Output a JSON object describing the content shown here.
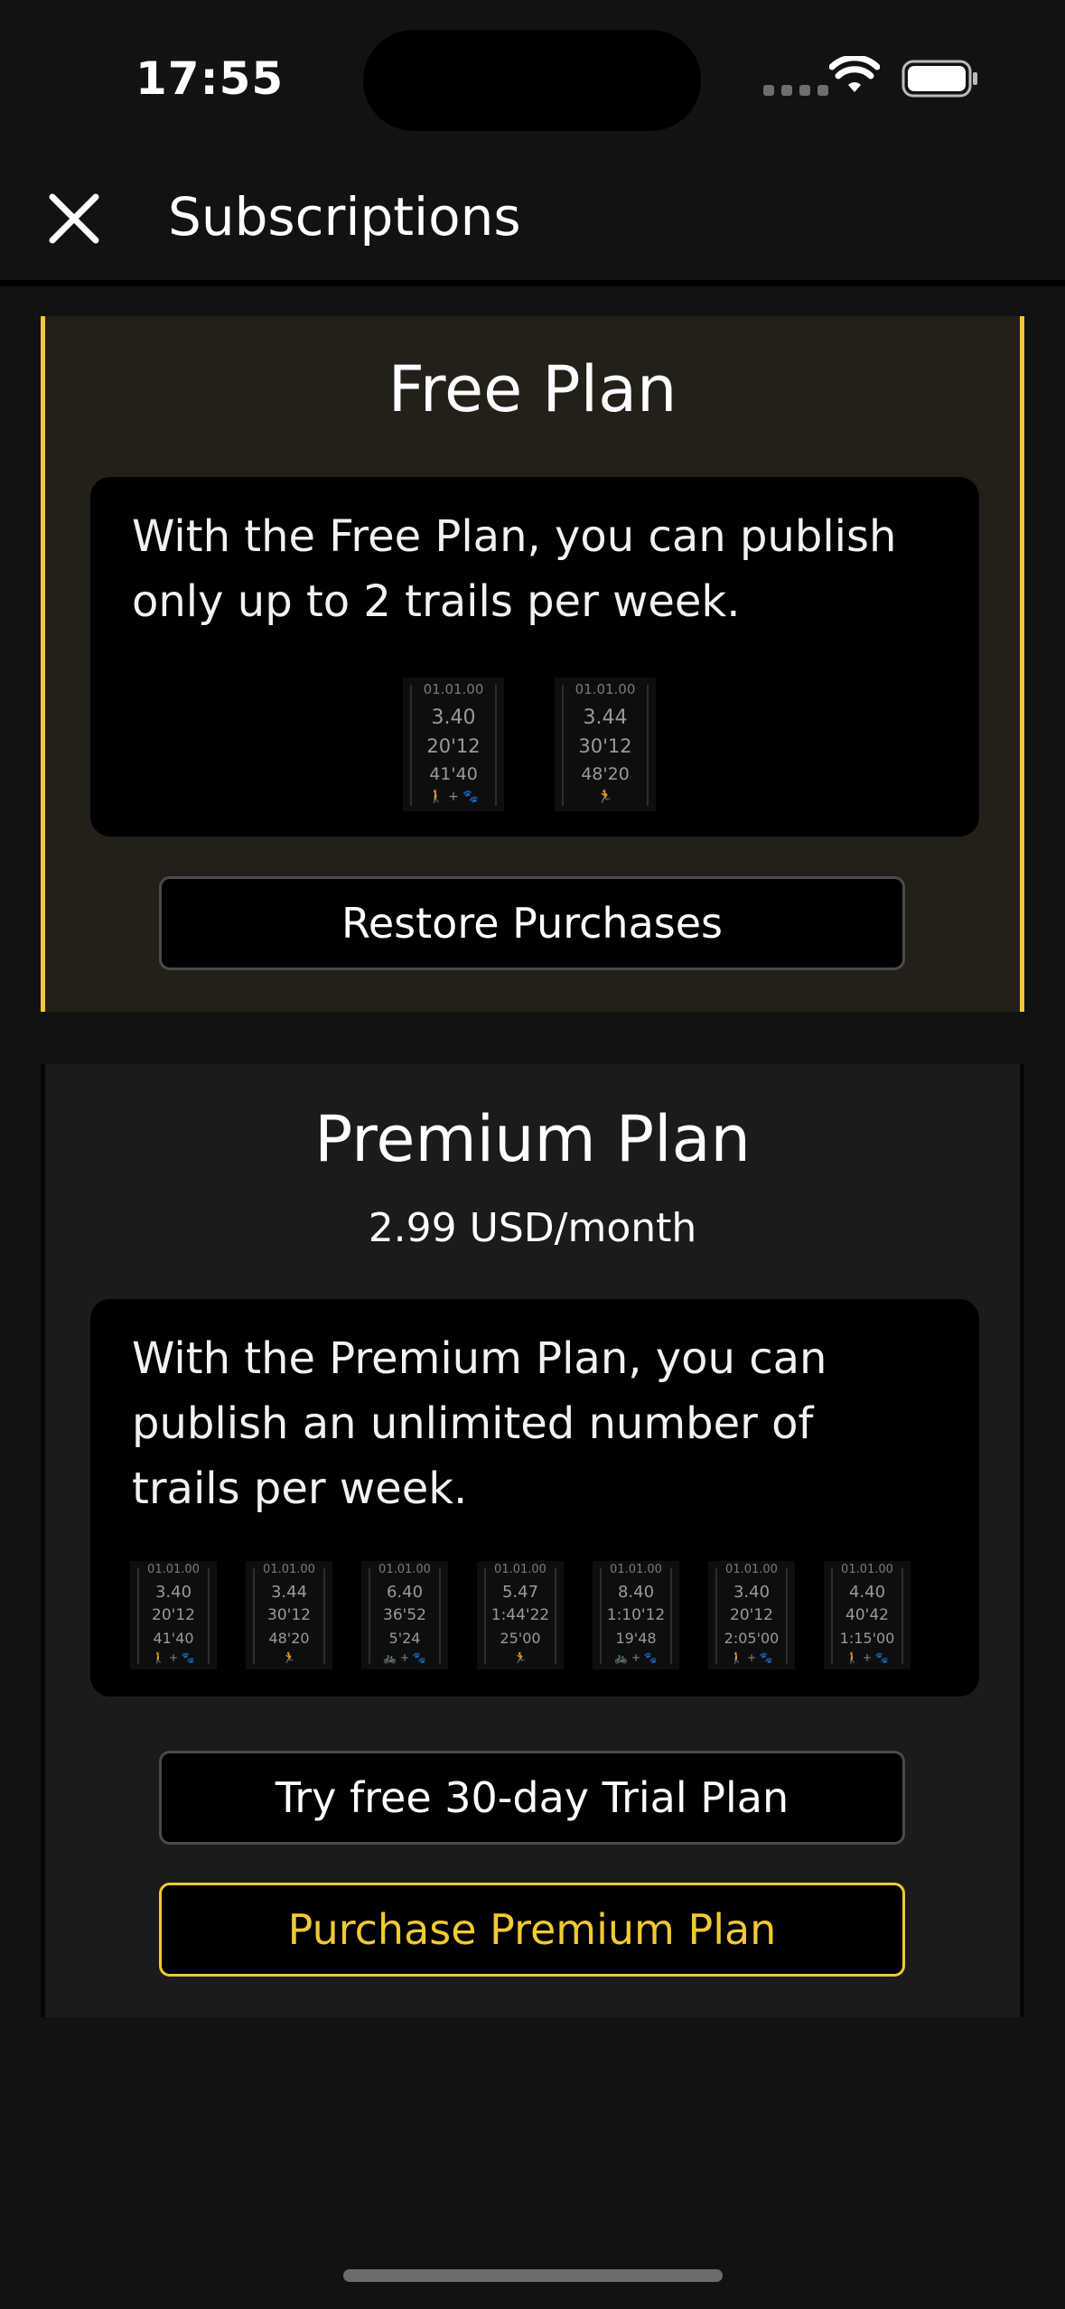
{
  "status_bar": {
    "time": "17:55"
  },
  "nav": {
    "title": "Subscriptions"
  },
  "free_plan": {
    "title": "Free Plan",
    "description": "With the Free Plan, you can publish only up to 2 trails per week.",
    "badges": [
      {
        "date": "01.01.00",
        "distance": "3.40",
        "time": "20'12",
        "pace": "41'40",
        "icons": "🚶 + 🐾"
      },
      {
        "date": "01.01.00",
        "distance": "3.44",
        "time": "30'12",
        "pace": "48'20",
        "icons": "🏃"
      }
    ],
    "restore_label": "Restore Purchases"
  },
  "premium_plan": {
    "title": "Premium Plan",
    "price": "2.99 USD/month",
    "description": "With the Premium Plan, you can publish an unlimited number of trails per week.",
    "badges": [
      {
        "date": "01.01.00",
        "distance": "3.40",
        "time": "20'12",
        "pace": "41'40",
        "icons": "🚶 + 🐾"
      },
      {
        "date": "01.01.00",
        "distance": "3.44",
        "time": "30'12",
        "pace": "48'20",
        "icons": "🏃"
      },
      {
        "date": "01.01.00",
        "distance": "6.40",
        "time": "36'52",
        "pace": "5'24",
        "icons": "🚲 + 🐾"
      },
      {
        "date": "01.01.00",
        "distance": "5.47",
        "time": "1:44'22",
        "pace": "25'00",
        "icons": "🏃"
      },
      {
        "date": "01.01.00",
        "distance": "8.40",
        "time": "1:10'12",
        "pace": "19'48",
        "icons": "🚲 + 🐾"
      },
      {
        "date": "01.01.00",
        "distance": "3.40",
        "time": "20'12",
        "pace": "2:05'00",
        "icons": "🚶 + 🐾"
      },
      {
        "date": "01.01.00",
        "distance": "4.40",
        "time": "40'42",
        "pace": "1:15'00",
        "icons": "🚶 + 🐾"
      }
    ],
    "trial_label": "Try free 30-day Trial Plan",
    "purchase_label": "Purchase Premium Plan"
  },
  "colors": {
    "accent": "#f2c934",
    "background": "#121212"
  }
}
